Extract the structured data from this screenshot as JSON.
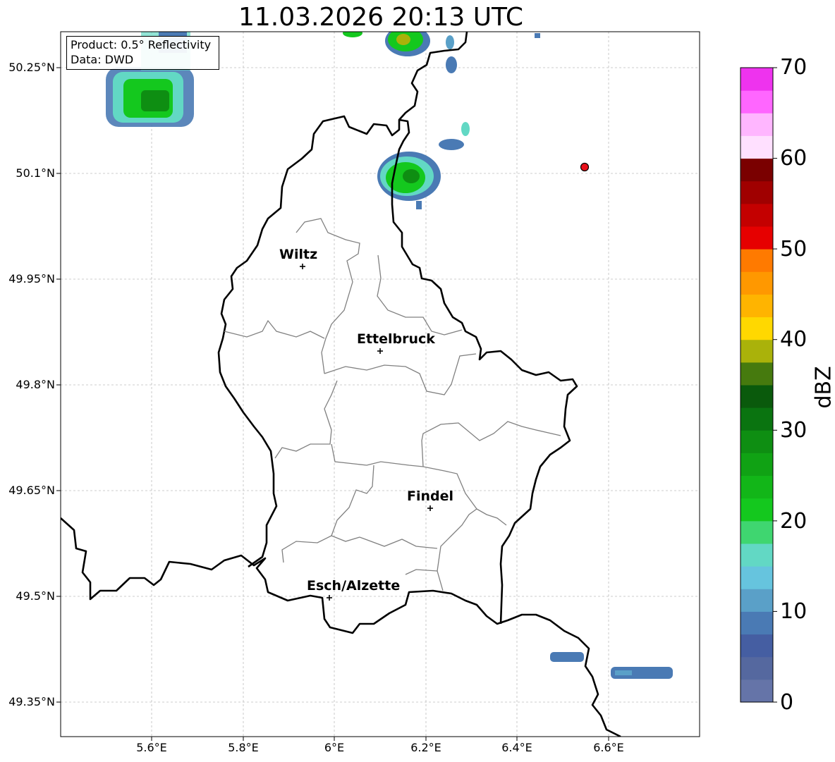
{
  "title": "11.03.2026 20:13 UTC",
  "info_box": {
    "product": "Product: 0.5° Reflectivity",
    "data": "Data: DWD"
  },
  "latitude_labels": [
    "50.25°N",
    "50.1°N",
    "49.95°N",
    "49.8°N",
    "49.65°N",
    "49.5°N",
    "49.35°N"
  ],
  "longitude_labels": [
    "5.6°E",
    "5.8°E",
    "6°E",
    "6.2°E",
    "6.4°E",
    "6.6°E"
  ],
  "map_extent": {
    "lon": [
      5.4,
      6.8
    ],
    "lat": [
      49.3,
      50.3
    ]
  },
  "cities": [
    {
      "name": "Wiltz",
      "lon": 5.93,
      "lat": 49.97
    },
    {
      "name": "Ettelbruck",
      "lon": 6.1,
      "lat": 49.85
    },
    {
      "name": "Findel",
      "lon": 6.21,
      "lat": 49.627
    },
    {
      "name": "Esch/Alzette",
      "lon": 5.99,
      "lat": 49.5
    }
  ],
  "radar_marker": {
    "lon": 6.55,
    "lat": 50.11,
    "color": "#e8101a"
  },
  "colorbar": {
    "label": "dBZ",
    "min": 0,
    "max": 70,
    "ticks": [
      "0",
      "10",
      "20",
      "30",
      "40",
      "50",
      "60",
      "70"
    ],
    "colors": [
      "#6574a8",
      "#55689f",
      "#455ea2",
      "#4a7ab4",
      "#5aa0c8",
      "#66c4de",
      "#62d8c4",
      "#3fd670",
      "#14c81e",
      "#12b618",
      "#10a214",
      "#0e8e12",
      "#0a7410",
      "#0a5a0c",
      "#467a0e",
      "#aab20a",
      "#ffd800",
      "#ffb400",
      "#ff9800",
      "#ff7a00",
      "#e60000",
      "#c40000",
      "#a00000",
      "#7a0000",
      "#ffe0ff",
      "#ffb6ff",
      "#ff66ff",
      "#ee33ee"
    ]
  }
}
